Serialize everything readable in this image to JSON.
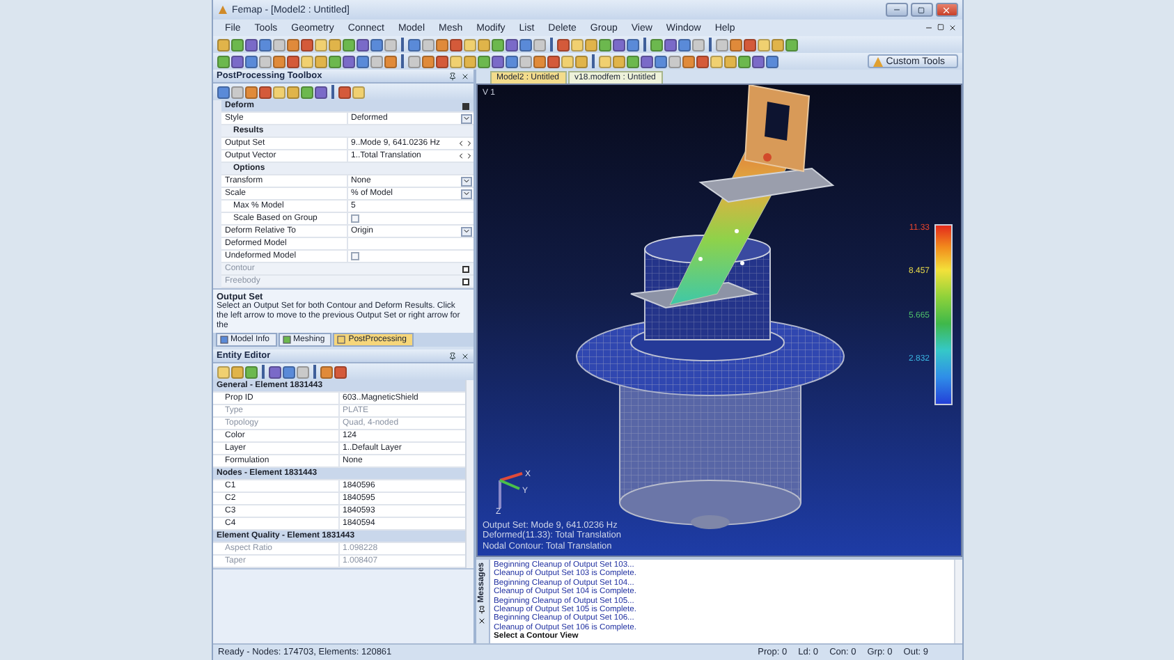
{
  "window": {
    "title": "Femap - [Model2 : Untitled]"
  },
  "menu": [
    "File",
    "Tools",
    "Geometry",
    "Connect",
    "Model",
    "Mesh",
    "Modify",
    "List",
    "Delete",
    "Group",
    "View",
    "Window",
    "Help"
  ],
  "custom_tools": "Custom Tools",
  "toolbox": {
    "title": "PostProcessing Toolbox",
    "sections": [
      {
        "title": "Deform",
        "expanded": true,
        "items": [
          {
            "kind": "dropdown",
            "label": "Style",
            "value": "Deformed"
          },
          {
            "kind": "group",
            "label": "Results",
            "items": [
              {
                "kind": "stepper",
                "label": "Output Set",
                "value": "9..Mode 9, 641.0236 Hz"
              },
              {
                "kind": "stepper",
                "label": "Output Vector",
                "value": "1..Total Translation"
              }
            ]
          },
          {
            "kind": "group",
            "label": "Options",
            "items": [
              {
                "kind": "dropdown",
                "label": "Transform",
                "value": "None"
              },
              {
                "kind": "dropdown",
                "label": "Scale",
                "value": "% of Model",
                "children": [
                  {
                    "kind": "text",
                    "label": "Max % Model",
                    "value": "5"
                  },
                  {
                    "kind": "checkbox",
                    "label": "Scale Based on Group",
                    "checked": false
                  }
                ]
              },
              {
                "kind": "dropdown",
                "label": "Deform Relative To",
                "value": "Origin"
              },
              {
                "kind": "text",
                "label": "Deformed Model"
              },
              {
                "kind": "checkbox",
                "label": "Undeformed Model",
                "checked": false
              }
            ]
          }
        ]
      },
      {
        "title": "Contour",
        "expanded": false
      },
      {
        "title": "Freebody",
        "expanded": false
      }
    ]
  },
  "help": {
    "title": "Output Set",
    "text": "Select an Output Set for both Contour and Deform Results. Click the left arrow to move to the previous Output Set or right arrow for the"
  },
  "panel_tabs": [
    {
      "label": "Model Info",
      "selected": false
    },
    {
      "label": "Meshing",
      "selected": false
    },
    {
      "label": "PostProcessing",
      "selected": true
    }
  ],
  "entity_editor": {
    "title": "Entity Editor",
    "sections": [
      {
        "title": "General - Element 1831443",
        "rows": [
          {
            "label": "Prop ID",
            "value": "603..MagneticShield",
            "disabled": false
          },
          {
            "label": "Type",
            "value": "PLATE",
            "disabled": true
          },
          {
            "label": "Topology",
            "value": "Quad, 4-noded",
            "disabled": true
          },
          {
            "label": "Color",
            "value": "124",
            "disabled": false
          },
          {
            "label": "Layer",
            "value": "1..Default Layer",
            "disabled": false
          },
          {
            "label": "Formulation",
            "value": "None",
            "disabled": false
          }
        ]
      },
      {
        "title": "Nodes - Element 1831443",
        "rows": [
          {
            "label": "C1",
            "value": "1840596",
            "disabled": false
          },
          {
            "label": "C2",
            "value": "1840595",
            "disabled": false
          },
          {
            "label": "C3",
            "value": "1840593",
            "disabled": false
          },
          {
            "label": "C4",
            "value": "1840594",
            "disabled": false
          }
        ]
      },
      {
        "title": "Element Quality - Element 1831443",
        "rows": [
          {
            "label": "Aspect Ratio",
            "value": "1.098228",
            "disabled": true
          },
          {
            "label": "Taper",
            "value": "1.008407",
            "disabled": true
          }
        ]
      }
    ]
  },
  "viewport": {
    "tabs": [
      {
        "label": "Model2 : Untitled",
        "selected": true
      },
      {
        "label": "v18.modfem : Untitled",
        "selected": false
      }
    ],
    "view_label": "V 1",
    "legend": [
      {
        "value": "11.33",
        "color": "#e8442c"
      },
      {
        "value": "8.457",
        "color": "#e6d84a"
      },
      {
        "value": "5.665",
        "color": "#4ec06a"
      },
      {
        "value": "2.832",
        "color": "#3ab4e0"
      }
    ],
    "axes": [
      "X",
      "Y",
      "Z"
    ],
    "info_lines": [
      "Output Set: Mode 9, 641.0236 Hz",
      "Deformed(11.33): Total Translation",
      "Nodal Contour: Total Translation"
    ]
  },
  "messages": {
    "title": "Messages",
    "lines": [
      "Beginning Cleanup of Output Set 103...",
      "Cleanup of Output Set 103 is Complete.",
      "Beginning Cleanup of Output Set 104...",
      "Cleanup of Output Set 104 is Complete.",
      "Beginning Cleanup of Output Set 105...",
      "Cleanup of Output Set 105 is Complete.",
      "Beginning Cleanup of Output Set 106...",
      "Cleanup of Output Set 106 is Complete."
    ],
    "prompt": "Select a Contour View"
  },
  "status_bar": {
    "message": "Ready - Nodes: 174703, Elements: 120861",
    "counters": [
      "Prop: 0",
      "Ld: 0",
      "Con: 0",
      "Grp: 0",
      "Out: 9"
    ]
  }
}
